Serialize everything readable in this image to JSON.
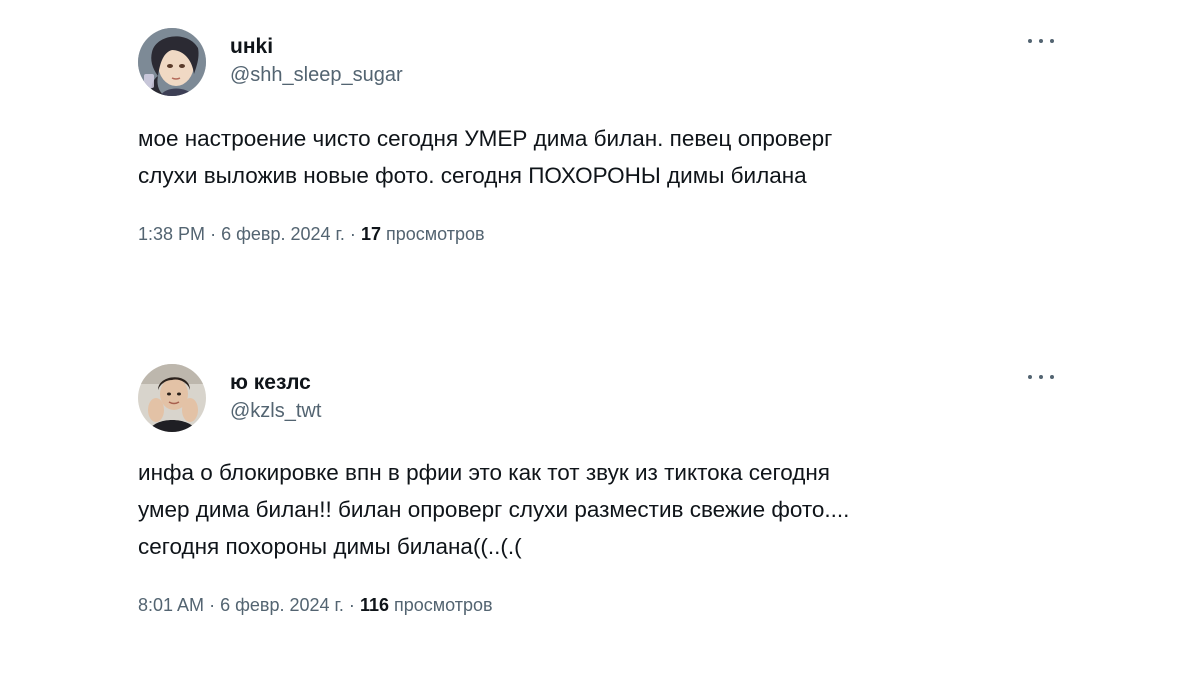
{
  "tweets": [
    {
      "display_name": "uнki",
      "handle": "@shh_sleep_sugar",
      "text": "мое настроение чисто сегодня УМЕР дима билан. певец опроверг\nслухи выложив новые фото. сегодня ПОХОРОНЫ димы билана",
      "time": "1:38 PM",
      "date": "6 февр. 2024 г.",
      "views_count": "17",
      "views_label": "просмотров",
      "avatar_icon": "avatar-anime-illustration",
      "more_icon": "more-options-icon"
    },
    {
      "display_name": "ю кезлс",
      "handle": "@kzls_twt",
      "text": "инфа о блокировке впн в рфии это как тот звук из тиктока сегодня\nумер дима билан!! билан опроверг слухи разместив свежие фото....\nсегодня похороны димы билана((..(.(",
      "time": "8:01 AM",
      "date": "6 февр. 2024 г.",
      "views_count": "116",
      "views_label": "просмотров",
      "avatar_icon": "avatar-photo",
      "more_icon": "more-options-icon"
    }
  ],
  "separator": "·",
  "colors": {
    "text_primary": "#0f1419",
    "text_secondary": "#536471",
    "background": "#ffffff"
  }
}
